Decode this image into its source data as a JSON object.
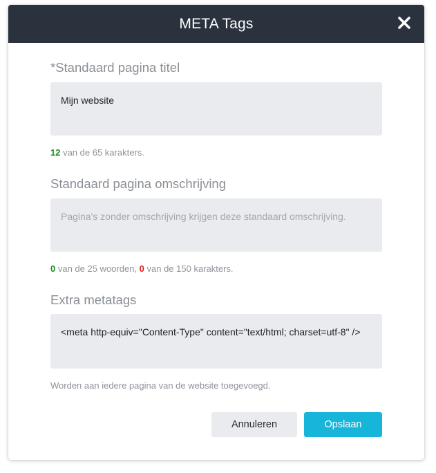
{
  "dialog": {
    "title": "META Tags"
  },
  "page_title": {
    "label": "*Standaard pagina titel",
    "value": "Mijn website",
    "count": "12",
    "counter_text": " van de 65 karakters."
  },
  "page_description": {
    "label": "Standaard pagina omschrijving",
    "placeholder": "Pagina's zonder omschrijving krijgen deze standaard omschrijving.",
    "word_count": "0",
    "words_text": " van de 25 woorden, ",
    "char_count": "0",
    "chars_text": " van de 150 karakters."
  },
  "extra_meta": {
    "label": "Extra metatags",
    "value": "<meta http-equiv=\"Content-Type\" content=\"text/html; charset=utf-8\" />",
    "help": "Worden aan iedere pagina van de website toegevoegd."
  },
  "buttons": {
    "cancel": "Annuleren",
    "save": "Opslaan"
  },
  "colors": {
    "header_bg": "#2a323d",
    "accent": "#17b5da",
    "count_ok": "#1e8a1e",
    "count_zero": "#e0201c"
  },
  "icons": {
    "close": "close-icon"
  }
}
